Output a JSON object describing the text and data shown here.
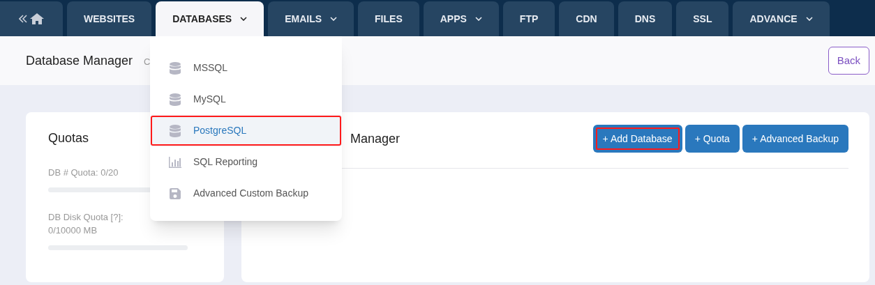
{
  "nav": {
    "tabs": [
      {
        "label": "WEBSITES",
        "selected": false,
        "caret": false
      },
      {
        "label": "DATABASES",
        "selected": true,
        "caret": true
      },
      {
        "label": "EMAILS",
        "selected": false,
        "caret": true
      },
      {
        "label": "FILES",
        "selected": false,
        "caret": false
      },
      {
        "label": "APPS",
        "selected": false,
        "caret": true
      },
      {
        "label": "FTP",
        "selected": false,
        "caret": false
      },
      {
        "label": "CDN",
        "selected": false,
        "caret": false
      },
      {
        "label": "DNS",
        "selected": false,
        "caret": false
      },
      {
        "label": "SSL",
        "selected": false,
        "caret": false
      },
      {
        "label": "ADVANCE",
        "selected": false,
        "caret": true
      }
    ]
  },
  "header": {
    "title": "Database Manager",
    "breadcrumb": "C",
    "back": "Back"
  },
  "dropdown": {
    "items": [
      {
        "label": "MSSQL",
        "kind": "database",
        "selected": false,
        "highlighted": false
      },
      {
        "label": "MySQL",
        "kind": "database",
        "selected": false,
        "highlighted": false
      },
      {
        "label": "PostgreSQL",
        "kind": "database",
        "selected": true,
        "highlighted": true
      },
      {
        "label": "SQL Reporting",
        "kind": "chart",
        "selected": false,
        "highlighted": false
      },
      {
        "label": "Advanced Custom Backup",
        "kind": "save",
        "selected": false,
        "highlighted": false
      }
    ]
  },
  "quotas": {
    "title": "Quotas",
    "items": [
      {
        "label": "DB # Quota: 0/20",
        "level": 0
      },
      {
        "label": "DB Disk Quota [?]:",
        "detail": "0/10000 MB",
        "level": 0
      }
    ]
  },
  "manager": {
    "title": "Manager",
    "buttons": [
      {
        "label": "+ Add Database",
        "highlighted": true
      },
      {
        "label": "+ Quota",
        "highlighted": false
      },
      {
        "label": "+ Advanced Backup",
        "highlighted": false
      }
    ]
  }
}
